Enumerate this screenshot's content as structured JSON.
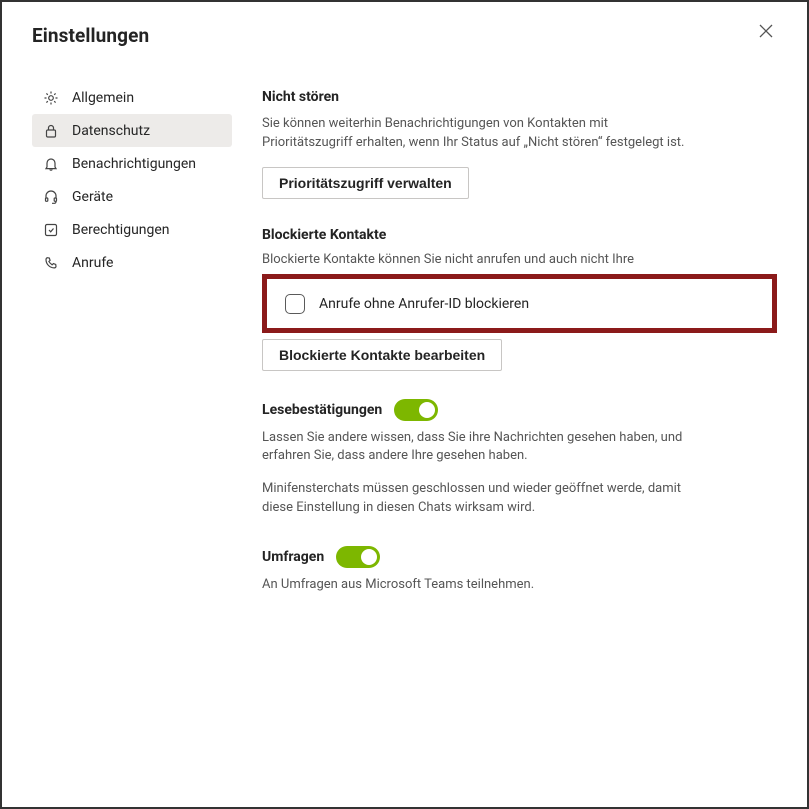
{
  "window": {
    "title": "Einstellungen"
  },
  "sidebar": {
    "items": [
      {
        "label": "Allgemein",
        "icon": "gear-icon",
        "active": false
      },
      {
        "label": "Datenschutz",
        "icon": "lock-icon",
        "active": true
      },
      {
        "label": "Benachrichtigungen",
        "icon": "bell-icon",
        "active": false
      },
      {
        "label": "Geräte",
        "icon": "headset-icon",
        "active": false
      },
      {
        "label": "Berechtigungen",
        "icon": "permissions-icon",
        "active": false
      },
      {
        "label": "Anrufe",
        "icon": "phone-icon",
        "active": false
      }
    ]
  },
  "main": {
    "dnd": {
      "title": "Nicht stören",
      "desc": "Sie können weiterhin Benachrichtigungen von Kontakten mit Prioritätszugriff erhalten, wenn Ihr Status auf „Nicht stören“ festgelegt ist.",
      "button": "Prioritätszugriff verwalten"
    },
    "blocked": {
      "title": "Blockierte Kontakte",
      "desc_line1": "Blockierte Kontakte können Sie nicht anrufen und auch nicht Ihre",
      "checkbox_label": "Anrufe ohne Anrufer-ID blockieren",
      "checkbox_checked": false,
      "edit_button": "Blockierte Kontakte bearbeiten"
    },
    "read_receipts": {
      "title": "Lesebestätigungen",
      "toggle_on": true,
      "desc1": "Lassen Sie andere wissen, dass Sie ihre Nachrichten gesehen haben, und erfahren Sie, dass andere Ihre gesehen haben.",
      "desc2": "Minifensterchats müssen geschlossen und wieder geöffnet werde, damit diese Einstellung in diesen Chats wirksam wird."
    },
    "surveys": {
      "title": "Umfragen",
      "toggle_on": true,
      "desc": "An Umfragen aus Microsoft Teams teilnehmen."
    }
  },
  "colors": {
    "toggle_on": "#7db700",
    "highlight_border": "#8b1a1a"
  }
}
